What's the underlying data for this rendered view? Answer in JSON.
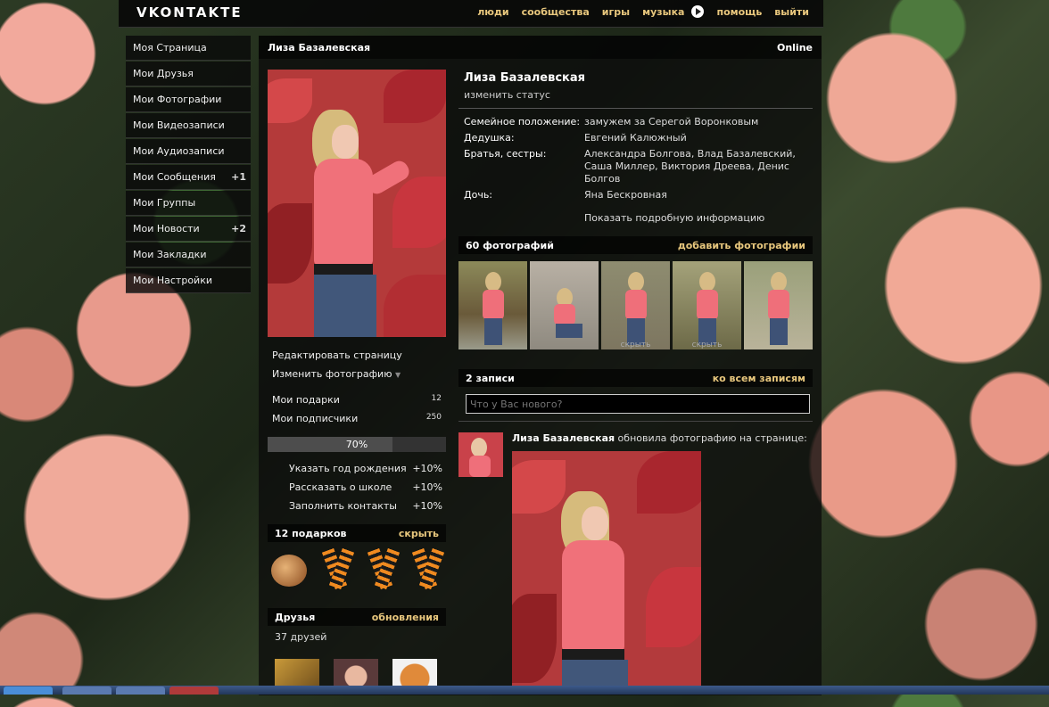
{
  "topbar": {
    "logo": "VKONTAKTE",
    "nav": {
      "people": "люди",
      "communities": "сообщества",
      "games": "игры",
      "music": "музыка",
      "help": "помощь",
      "logout": "выйти"
    }
  },
  "menu": {
    "items": [
      {
        "label": "Моя Страница",
        "count": ""
      },
      {
        "label": "Мои Друзья",
        "count": ""
      },
      {
        "label": "Мои Фотографии",
        "count": ""
      },
      {
        "label": "Мои Видеозаписи",
        "count": ""
      },
      {
        "label": "Мои Аудиозаписи",
        "count": ""
      },
      {
        "label": "Мои Сообщения",
        "count": "+1"
      },
      {
        "label": "Мои Группы",
        "count": ""
      },
      {
        "label": "Мои Новости",
        "count": "+2"
      },
      {
        "label": "Мои Закладки",
        "count": ""
      },
      {
        "label": "Мои Настройки",
        "count": ""
      }
    ]
  },
  "profile": {
    "header_name": "Лиза Базалевская",
    "online": "Online",
    "name": "Лиза Базалевская",
    "status": "изменить статус",
    "info": [
      {
        "label": "Семейное положение:",
        "value": "замужем за Серегой Воронковым"
      },
      {
        "label": "Дедушка:",
        "value": "Евгений Калюжный"
      },
      {
        "label": "Братья, сестры:",
        "value": "Александра Болгова, Влад Базалевский, Саша Миллер, Виктория Дреева, Денис Болгов"
      },
      {
        "label": "Дочь:",
        "value": "Яна Бескровная"
      }
    ],
    "more_info": "Показать подробную информацию"
  },
  "left": {
    "edit_page": "Редактировать страницу",
    "change_photo": "Изменить фотографию",
    "gifts_label": "Мои подарки",
    "gifts_count": "12",
    "followers_label": "Мои подписчики",
    "followers_count": "250",
    "progress_text": "70%",
    "progress_value": 70,
    "tasks": [
      {
        "label": "Указать год рождения",
        "value": "+10%"
      },
      {
        "label": "Рассказать о школе",
        "value": "+10%"
      },
      {
        "label": "Заполнить контакты",
        "value": "+10%"
      }
    ],
    "gifts_section": {
      "title": "12 подарков",
      "action": "скрыть"
    },
    "friends_section": {
      "title": "Друзья",
      "action": "обновления",
      "count": "37 друзей"
    }
  },
  "photos": {
    "title": "60 фотографий",
    "action": "добавить фотографии",
    "hidden_label": "скрыть"
  },
  "wall": {
    "title": "2 записи",
    "action": "ко всем записям",
    "placeholder": "Что у Вас нового?",
    "post_author": "Лиза Базалевская",
    "post_text": " обновила фотографию на странице:"
  },
  "colors": {
    "link_accent": "#e8c77d",
    "panel": "#0c0c0c"
  }
}
